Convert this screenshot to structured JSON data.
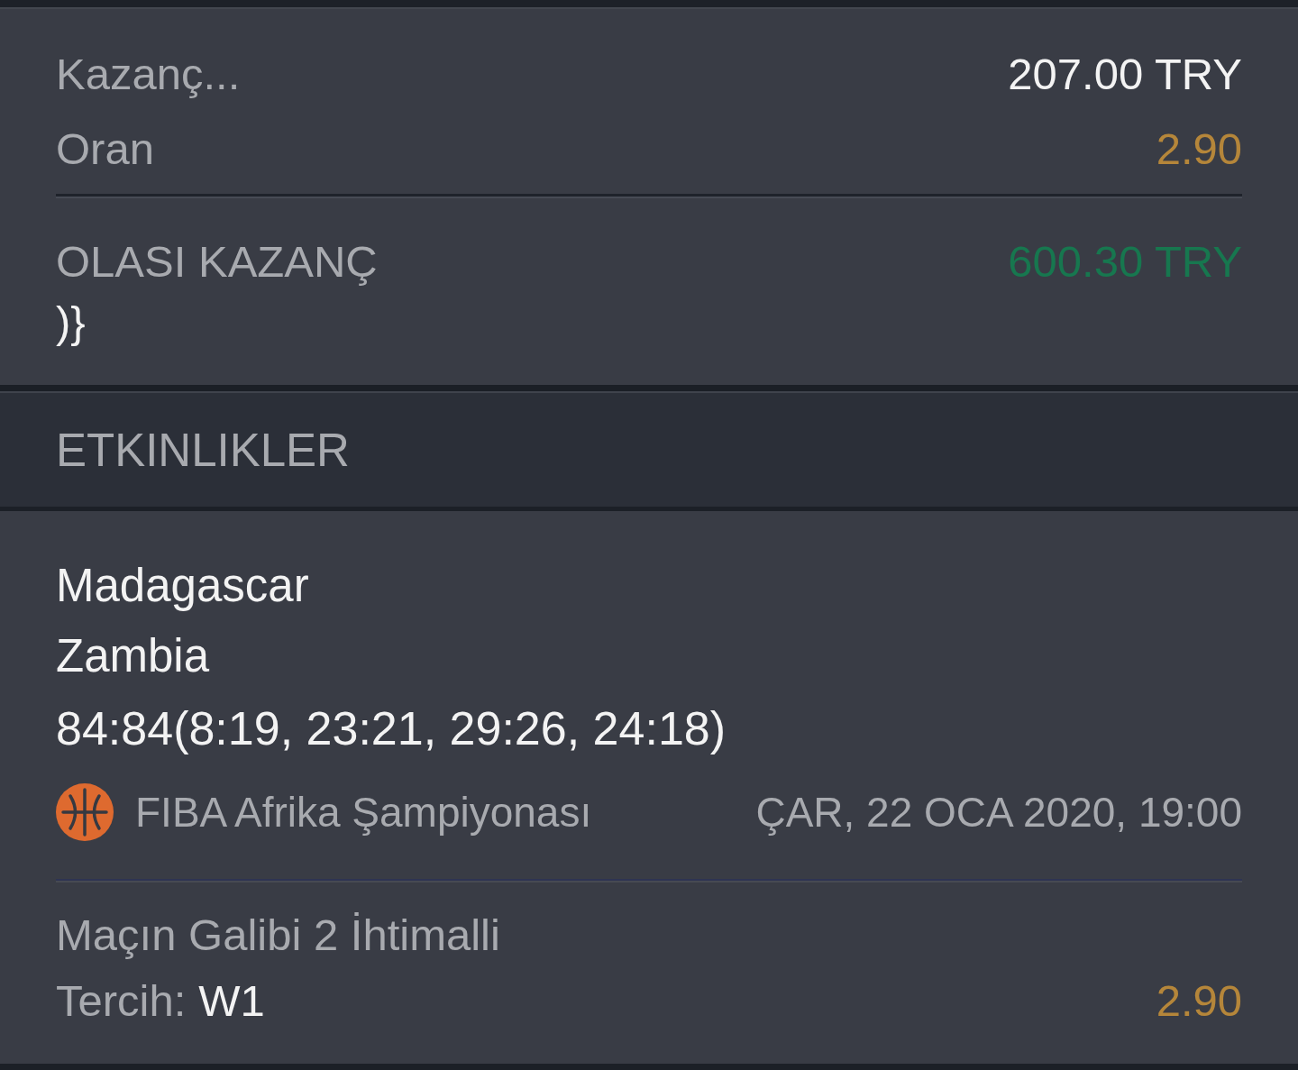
{
  "summary": {
    "rows": [
      {
        "kind": "amount",
        "label": "Kazanç...",
        "value": "207.00 TRY"
      },
      {
        "kind": "odds",
        "label": "Oran",
        "value": "2.90"
      }
    ],
    "potential_win": {
      "label": "OLASI KAZANÇ",
      "value": "600.30 TRY"
    },
    "trailing_text": ")}"
  },
  "events_header": {
    "title": "ETKINLIKLER"
  },
  "events": [
    {
      "home": "Madagascar",
      "away": "Zambia",
      "score": "84:84(8:19, 23:21, 29:26, 24:18)",
      "league": "FIBA Afrika Şampiyonası",
      "date": "ÇAR, 22 OCA 2020, 19:00",
      "market": "Maçın Galibi 2 İhtimalli",
      "pick_label": "Tercih:",
      "pick": "W1",
      "odds": "2.90"
    }
  ]
}
